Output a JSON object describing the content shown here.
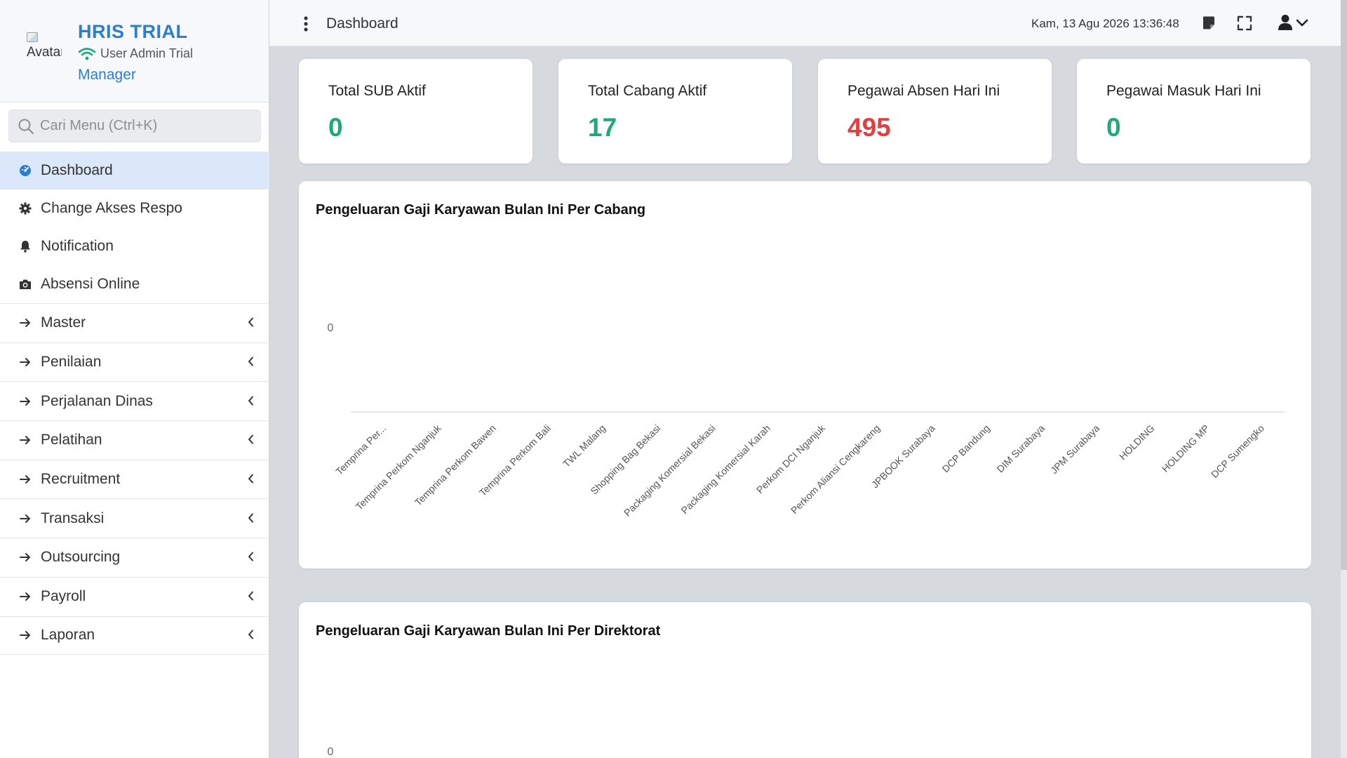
{
  "sidebar": {
    "avatar_alt": "Avatar",
    "app_title": "HRIS TRIAL",
    "user_name": "User Admin Trial",
    "role": "Manager",
    "search_placeholder": "Cari Menu (Ctrl+K)",
    "items": [
      {
        "label": "Dashboard",
        "icon": "dashboard-icon",
        "active": true
      },
      {
        "label": "Change Akses Respo",
        "icon": "gear-icon"
      },
      {
        "label": "Notification",
        "icon": "bell-icon"
      },
      {
        "label": "Absensi Online",
        "icon": "camera-icon"
      }
    ],
    "groups": [
      {
        "label": "Master"
      },
      {
        "label": "Penilaian"
      },
      {
        "label": "Perjalanan Dinas"
      },
      {
        "label": "Pelatihan"
      },
      {
        "label": "Recruitment"
      },
      {
        "label": "Transaksi"
      },
      {
        "label": "Outsourcing"
      },
      {
        "label": "Payroll"
      },
      {
        "label": "Laporan"
      }
    ]
  },
  "topbar": {
    "page_title": "Dashboard",
    "datetime": "Kam, 13 Agu 2026 13:36:48",
    "icons": [
      "kebab-menu-icon",
      "sticky-note-icon",
      "fullscreen-icon",
      "user-icon",
      "chevron-down-icon"
    ]
  },
  "stats": [
    {
      "label": "Total SUB Aktif",
      "value": "0",
      "color": "#1fa97a"
    },
    {
      "label": "Total Cabang Aktif",
      "value": "17",
      "color": "#1fa97a"
    },
    {
      "label": "Pegawai Absen Hari Ini",
      "value": "495",
      "color": "#e04040"
    },
    {
      "label": "Pegawai Masuk Hari Ini",
      "value": "0",
      "color": "#1fa97a"
    }
  ],
  "charts": {
    "cabang_title": "Pengeluaran Gaji Karyawan Bulan Ini Per Cabang",
    "direktorat_title": "Pengeluaran Gaji Karyawan Bulan Ini Per Direktorat"
  },
  "chart_data": [
    {
      "type": "bar",
      "title": "Pengeluaran Gaji Karyawan Bulan Ini Per Cabang",
      "categories": [
        "Temprina Per...",
        "Temprina Perkom Nganjuk",
        "Temprina Perkom Bawen",
        "Temprina Perkom Bali",
        "TWL Malang",
        "Shopping Bag Bekasi",
        "Packaging Komersial Bekasi",
        "Packaging Komersial Karah",
        "Perkom DCI Nganjuk",
        "Perkom Aliansi Cengkareng",
        "JPBOOK Surabaya",
        "DCP Bandung",
        "DIM Surabaya",
        "JPM Surabaya",
        "HOLDING",
        "HOLDING MP",
        "DCP Sumengko"
      ],
      "values": [
        0,
        0,
        0,
        0,
        0,
        0,
        0,
        0,
        0,
        0,
        0,
        0,
        0,
        0,
        0,
        0,
        0
      ],
      "yticks": [
        "0"
      ],
      "xlabel": "",
      "ylabel": "",
      "grid": false
    },
    {
      "type": "bar",
      "title": "Pengeluaran Gaji Karyawan Bulan Ini Per Direktorat",
      "categories": [],
      "values": [],
      "yticks": [
        "0"
      ],
      "xlabel": "",
      "ylabel": "",
      "grid": false
    }
  ]
}
